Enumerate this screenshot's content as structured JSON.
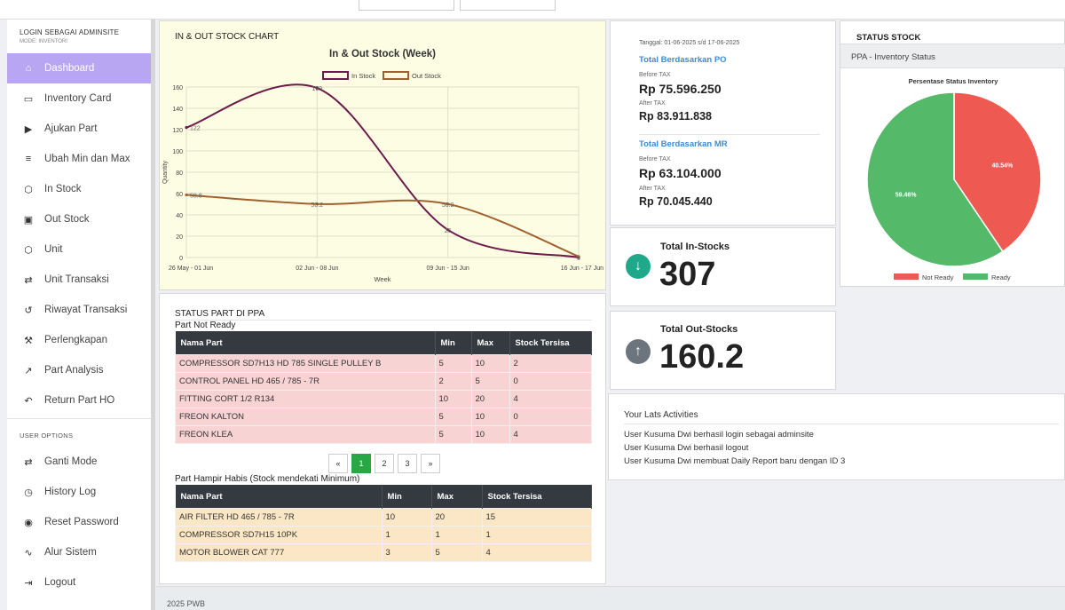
{
  "sidebar": {
    "login_title": "LOGIN SEBAGAI ADMINSITE",
    "mode": "MODE: INVENTORI",
    "items": [
      {
        "label": "Dashboard",
        "icon": "home-icon"
      },
      {
        "label": "Inventory Card",
        "icon": "card-icon"
      },
      {
        "label": "Ajukan Part",
        "icon": "play-circle-icon"
      },
      {
        "label": "Ubah Min dan Max",
        "icon": "sliders-icon"
      },
      {
        "label": "In Stock",
        "icon": "cube-icon"
      },
      {
        "label": "Out Stock",
        "icon": "box-icon"
      },
      {
        "label": "Unit",
        "icon": "cube-icon"
      },
      {
        "label": "Unit Transaksi",
        "icon": "exchange-icon"
      },
      {
        "label": "Riwayat Transaksi",
        "icon": "history-icon"
      },
      {
        "label": "Perlengkapan",
        "icon": "wrench-icon"
      },
      {
        "label": "Part Analysis",
        "icon": "chart-line-icon"
      },
      {
        "label": "Return Part HO",
        "icon": "undo-icon"
      }
    ],
    "options_title": "USER OPTIONS",
    "options": [
      {
        "label": "Ganti Mode",
        "icon": "exchange-icon"
      },
      {
        "label": "History Log",
        "icon": "clock-icon"
      },
      {
        "label": "Reset Password",
        "icon": "reset-icon"
      },
      {
        "label": "Alur Sistem",
        "icon": "flow-icon"
      },
      {
        "label": "Logout",
        "icon": "logout-icon"
      }
    ]
  },
  "chart_card": {
    "title": "IN & OUT STOCK CHART"
  },
  "chart_data": {
    "type": "line",
    "title": "In & Out Stock (Week)",
    "xlabel": "Week",
    "ylabel": "Quantity",
    "categories": [
      "26 May - 01 Jun",
      "02 Jun - 08 Jun",
      "09 Jun - 15 Jun",
      "16 Jun - 17 Jun"
    ],
    "ylim": [
      0,
      160
    ],
    "yticks": [
      0,
      20,
      40,
      60,
      80,
      100,
      120,
      140,
      160
    ],
    "series": [
      {
        "name": "In Stock",
        "color": "#6b1a4a",
        "values": [
          122,
          159,
          26,
          0
        ]
      },
      {
        "name": "Out Stock",
        "color": "#a0612e",
        "values": [
          58.8,
          50.2,
          50.2,
          1
        ]
      }
    ],
    "data_labels": [
      {
        "text": "122",
        "series": 0,
        "index": 0
      },
      {
        "text": "159",
        "series": 0,
        "index": 1
      },
      {
        "text": "26",
        "series": 0,
        "index": 2
      },
      {
        "text": "0",
        "series": 0,
        "index": 3
      },
      {
        "text": "58.8",
        "series": 1,
        "index": 0
      },
      {
        "text": "50.2",
        "series": 1,
        "index": 1
      },
      {
        "text": "50.2",
        "series": 1,
        "index": 2
      }
    ],
    "grid": true,
    "legend": "top-center"
  },
  "tax": {
    "date": "Tanggal: 01-06-2025 s/d 17-06-2025",
    "po_title": "Total Berdasarkan PO",
    "before_label": "Before TAX",
    "after_label": "After TAX",
    "po_before": "Rp 75.596.250",
    "po_after": "Rp 83.911.838",
    "mr_title": "Total Berdasarkan MR",
    "mr_before": "Rp 63.104.000",
    "mr_after": "Rp 70.045.440"
  },
  "in_stock": {
    "title": "Total In-Stocks",
    "value": "307",
    "icon": "arrow-down-circle-icon",
    "color": "#1fa98a"
  },
  "out_stock": {
    "title": "Total Out-Stocks",
    "value": "160.2",
    "icon": "arrow-up-circle-icon",
    "color": "#6c757d"
  },
  "status_stock": {
    "title": "STATUS STOCK",
    "subtitle": "PPA - Inventory Status",
    "pie_title": "Persentase Status Inventory",
    "slices": [
      {
        "label": "Not Ready",
        "value": 40.54,
        "text": "40.54%",
        "color": "#ee5a52"
      },
      {
        "label": "Ready",
        "value": 59.46,
        "text": "59.46%",
        "color": "#55b96a"
      }
    ]
  },
  "status_part": {
    "title": "STATUS PART DI PPA",
    "not_ready_title": "Part Not Ready",
    "headers": [
      "Nama Part",
      "Min",
      "Max",
      "Stock Tersisa"
    ],
    "not_ready_rows": [
      [
        "COMPRESSOR SD7H13 HD 785 SINGLE PULLEY B",
        "5",
        "10",
        "2"
      ],
      [
        "CONTROL PANEL HD 465 / 785 - 7R",
        "2",
        "5",
        "0"
      ],
      [
        "FITTING CORT 1/2 R134",
        "10",
        "20",
        "4"
      ],
      [
        "FREON KALTON",
        "5",
        "10",
        "0"
      ],
      [
        "FREON KLEA",
        "5",
        "10",
        "4"
      ]
    ],
    "pagination": [
      "«",
      "1",
      "2",
      "3",
      "»"
    ],
    "near_min_title": "Part Hampir Habis (Stock mendekati Minimum)",
    "near_min_rows": [
      [
        "AIR FILTER HD 465 / 785 - 7R",
        "10",
        "20",
        "15"
      ],
      [
        "COMPRESSOR SD7H15 10PK",
        "1",
        "1",
        "1"
      ],
      [
        "MOTOR BLOWER CAT 777",
        "3",
        "5",
        "4"
      ]
    ]
  },
  "activities": {
    "title": "Your Lats Activities",
    "items": [
      "User Kusuma Dwi berhasil login sebagai adminsite",
      "User Kusuma Dwi berhasil logout",
      "User Kusuma Dwi membuat Daily Report baru dengan ID 3"
    ]
  },
  "footer": "2025 PWB"
}
